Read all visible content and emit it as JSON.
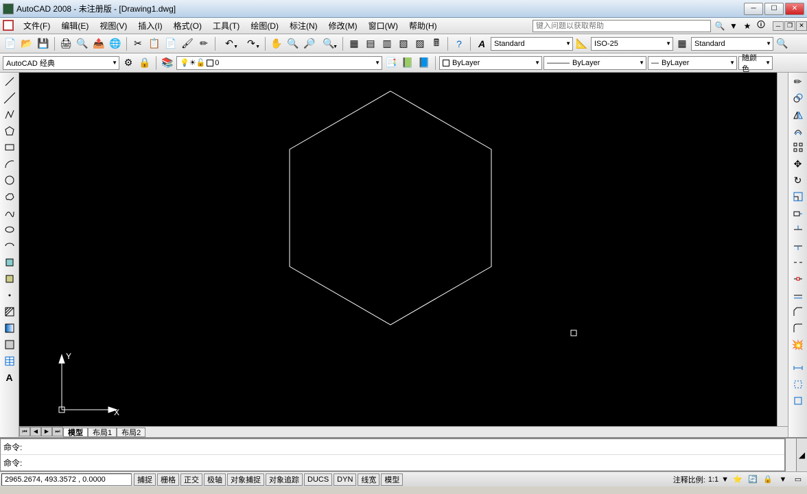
{
  "window": {
    "title": "AutoCAD 2008 - 未注册版 - [Drawing1.dwg]"
  },
  "menu": {
    "items": [
      "文件(F)",
      "编辑(E)",
      "视图(V)",
      "插入(I)",
      "格式(O)",
      "工具(T)",
      "绘图(D)",
      "标注(N)",
      "修改(M)",
      "窗口(W)",
      "帮助(H)"
    ],
    "search_placeholder": "键入问题以获取帮助"
  },
  "toolbar1": {
    "workspace": "AutoCAD 经典",
    "layer": "0",
    "text_style": "Standard",
    "dim_style": "ISO-25",
    "table_style": "Standard"
  },
  "toolbar2": {
    "prop1": "ByLayer",
    "prop2": "ByLayer",
    "prop3": "ByLayer",
    "prop4": "随颜色"
  },
  "tabs": {
    "items": [
      "模型",
      "布局1",
      "布局2"
    ]
  },
  "command": {
    "line1": "命令:",
    "line2": "命令:"
  },
  "status": {
    "coords": "2965.2674, 493.3572 , 0.0000",
    "toggles": [
      "捕捉",
      "栅格",
      "正交",
      "极轴",
      "对象捕捉",
      "对象追踪",
      "DUCS",
      "DYN",
      "线宽",
      "模型"
    ],
    "scale_label": "注释比例:",
    "scale_value": "1:1"
  },
  "canvas": {
    "ucs_y": "Y",
    "ucs_x": "X"
  }
}
